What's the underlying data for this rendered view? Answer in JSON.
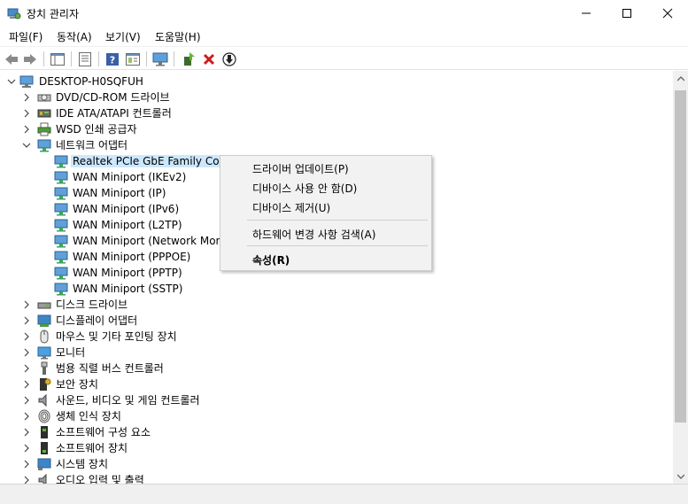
{
  "window": {
    "title": "장치 관리자",
    "minimize_icon": "minimize-icon",
    "maximize_icon": "maximize-icon",
    "close_icon": "close-icon"
  },
  "menu": [
    "파일(F)",
    "동작(A)",
    "보기(V)",
    "도움말(H)"
  ],
  "toolbar": [
    "back-icon",
    "forward-icon",
    "show-hide-tree-icon",
    "properties-icon",
    "help-icon",
    "view-icon",
    "scan-hardware-icon",
    "update-driver-icon",
    "uninstall-icon",
    "disable-icon"
  ],
  "tree": {
    "root": "DESKTOP-H0SQFUH",
    "categories_before": [
      {
        "label": "DVD/CD-ROM 드라이브",
        "icon": "dvd-drive-icon"
      },
      {
        "label": "IDE ATA/ATAPI 컨트롤러",
        "icon": "ide-controller-icon"
      },
      {
        "label": "WSD 인쇄 공급자",
        "icon": "printer-icon"
      }
    ],
    "network": {
      "label": "네트워크 어댑터",
      "icon": "network-adapter-icon",
      "children": [
        "Realtek PCIe GbE Family Controller",
        "WAN Miniport (IKEv2)",
        "WAN Miniport (IP)",
        "WAN Miniport (IPv6)",
        "WAN Miniport (L2TP)",
        "WAN Miniport (Network Monitor)",
        "WAN Miniport (PPPOE)",
        "WAN Miniport (PPTP)",
        "WAN Miniport (SSTP)"
      ],
      "selected_index": 0
    },
    "categories_after": [
      {
        "label": "디스크 드라이브",
        "icon": "disk-drive-icon"
      },
      {
        "label": "디스플레이 어댑터",
        "icon": "display-adapter-icon"
      },
      {
        "label": "마우스 및 기타 포인팅 장치",
        "icon": "mouse-icon"
      },
      {
        "label": "모니터",
        "icon": "monitor-icon"
      },
      {
        "label": "범용 직렬 버스 컨트롤러",
        "icon": "usb-icon"
      },
      {
        "label": "보안 장치",
        "icon": "security-device-icon"
      },
      {
        "label": "사운드, 비디오 및 게임 컨트롤러",
        "icon": "speaker-icon"
      },
      {
        "label": "생체 인식 장치",
        "icon": "fingerprint-icon"
      },
      {
        "label": "소프트웨어 구성 요소",
        "icon": "software-component-icon"
      },
      {
        "label": "소프트웨어 장치",
        "icon": "software-device-icon"
      },
      {
        "label": "시스템 장치",
        "icon": "system-device-icon"
      },
      {
        "label": "오디오 입력 및 출력",
        "icon": "audio-io-icon"
      }
    ]
  },
  "context_menu": {
    "items": [
      {
        "label": "드라이버 업데이트(P)",
        "bold": false
      },
      {
        "label": "디바이스 사용 안 함(D)",
        "bold": false
      },
      {
        "label": "디바이스 제거(U)",
        "bold": false
      },
      {
        "label": "하드웨어 변경 사항 검색(A)",
        "bold": false
      },
      {
        "label": "속성(R)",
        "bold": true
      }
    ]
  },
  "colors": {
    "selection": "#cce8ff",
    "menu_bg": "#f2f2f2",
    "scrollbar_thumb": "#c2c2c2"
  }
}
